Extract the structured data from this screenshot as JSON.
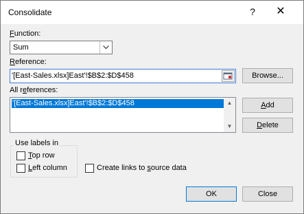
{
  "dialog": {
    "title": "Consolidate",
    "help_glyph": "?",
    "close_glyph": "✕"
  },
  "function": {
    "label_first": "F",
    "label_rest": "unction:",
    "selected": "Sum"
  },
  "reference": {
    "label_first": "R",
    "label_rest": "eference:",
    "value": "'[East-Sales.xlsx]East'!$B$2:$D$458",
    "browse_label": "Browse..."
  },
  "all_references": {
    "label_before": "All r",
    "label_u": "e",
    "label_after": "ferences:",
    "items": [
      "'[East-Sales.xlsx]East'!$B$2:$D$458"
    ],
    "add_u": "A",
    "add_rest": "dd",
    "delete_u": "D",
    "delete_rest": "elete"
  },
  "use_labels": {
    "group_label": "Use labels in",
    "top_row_u": "T",
    "top_row_rest": "op row",
    "top_row_checked": false,
    "left_column_u": "L",
    "left_column_rest": "eft column",
    "left_column_checked": false
  },
  "links": {
    "label_before": "Create links to ",
    "label_u": "s",
    "label_after": "ource data",
    "checked": false
  },
  "footer": {
    "ok_label": "OK",
    "close_label": "Close"
  }
}
